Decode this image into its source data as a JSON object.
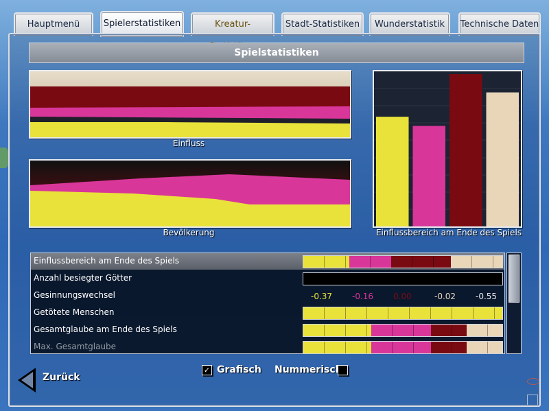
{
  "tabs": [
    {
      "label": "Hauptmenü",
      "active": false
    },
    {
      "label": "Spielerstatistiken",
      "active": true
    },
    {
      "label": "Kreatur-Statistiken",
      "active": false
    },
    {
      "label": "Stadt-Statistiken",
      "active": false
    },
    {
      "label": "Wunderstatistik",
      "active": false
    },
    {
      "label": "Technische Daten",
      "active": false
    }
  ],
  "heading": "Spielstatistiken",
  "colors": {
    "yellow": "#e9e23a",
    "pink": "#d9369a",
    "darkred": "#7a0a12",
    "beige": "#e9d6b8"
  },
  "charts": {
    "einfluss": {
      "caption": "Einfluss"
    },
    "bevoelkerung": {
      "caption": "Bevölkerung"
    },
    "einflussbereich": {
      "caption": "Einflussbereich am Ende des Spiels",
      "values": [
        0.72,
        0.66,
        1.0,
        0.88
      ]
    }
  },
  "stats": [
    {
      "label": "Einflussbereich am Ende des Spiels",
      "selected": true,
      "type": "bar",
      "shares": [
        0.23,
        0.21,
        0.3,
        0.26
      ]
    },
    {
      "label": "Anzahl besiegter Götter",
      "selected": false,
      "type": "bar",
      "shares": []
    },
    {
      "label": "Gesinnungswechsel",
      "selected": false,
      "type": "numbers",
      "numbers": [
        "-0.37",
        "-0.16",
        "0.00",
        "-0.02",
        "-0.55"
      ]
    },
    {
      "label": "Getötete Menschen",
      "selected": false,
      "type": "bar",
      "shares": [
        1.0,
        0,
        0,
        0
      ]
    },
    {
      "label": "Gesamtglaube am Ende des Spiels",
      "selected": false,
      "type": "bar",
      "shares": [
        0.34,
        0.3,
        0.18,
        0.18
      ]
    },
    {
      "label": "Max. Gesamtglaube",
      "selected": false,
      "type": "bar",
      "shares": [
        0.34,
        0.3,
        0.18,
        0.18
      ]
    }
  ],
  "footer": {
    "back_label": "Zurück",
    "grafisch_label": "Grafisch",
    "grafisch_checked": true,
    "grafisch_mark": "✓",
    "nummerisch_label": "Nummerisch",
    "nummerisch_checked": false
  }
}
